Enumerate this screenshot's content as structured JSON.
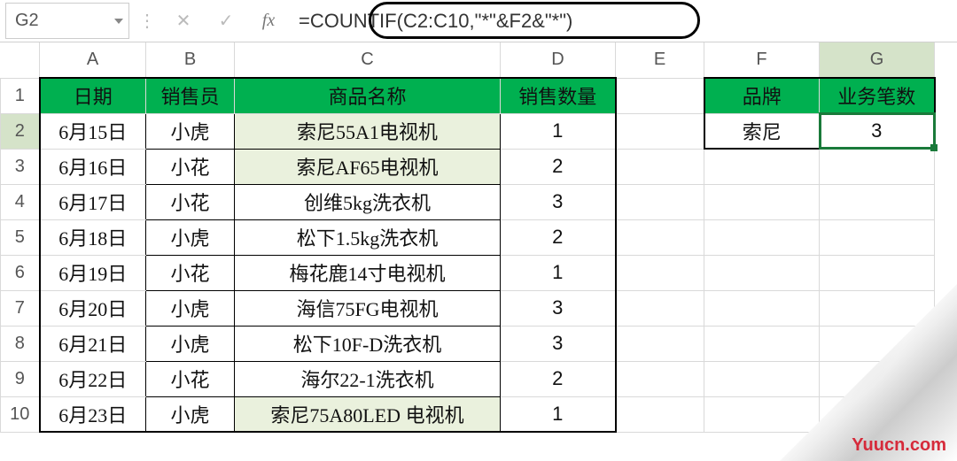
{
  "formula_bar": {
    "cell_ref": "G2",
    "cancel_glyph": "✕",
    "accept_glyph": "✓",
    "fx_label": "fx",
    "formula": "=COUNTIF(C2:C10,\"*\"&F2&\"*\")"
  },
  "columns": [
    "A",
    "B",
    "C",
    "D",
    "E",
    "F",
    "G"
  ],
  "row_numbers": [
    "1",
    "2",
    "3",
    "4",
    "5",
    "6",
    "7",
    "8",
    "9",
    "10"
  ],
  "main_table": {
    "headers": {
      "A": "日期",
      "B": "销售员",
      "C": "商品名称",
      "D": "销售数量"
    },
    "rows": [
      {
        "A": "6月15日",
        "B": "小虎",
        "C": "索尼55A1电视机",
        "D": "1",
        "hl": true
      },
      {
        "A": "6月16日",
        "B": "小花",
        "C": "索尼AF65电视机",
        "D": "2",
        "hl": true
      },
      {
        "A": "6月17日",
        "B": "小花",
        "C": "创维5kg洗衣机",
        "D": "3",
        "hl": false
      },
      {
        "A": "6月18日",
        "B": "小虎",
        "C": "松下1.5kg洗衣机",
        "D": "2",
        "hl": false
      },
      {
        "A": "6月19日",
        "B": "小花",
        "C": "梅花鹿14寸电视机",
        "D": "1",
        "hl": false
      },
      {
        "A": "6月20日",
        "B": "小虎",
        "C": "海信75FG电视机",
        "D": "3",
        "hl": false
      },
      {
        "A": "6月21日",
        "B": "小虎",
        "C": "松下10F-D洗衣机",
        "D": "3",
        "hl": false
      },
      {
        "A": "6月22日",
        "B": "小花",
        "C": "海尔22-1洗衣机",
        "D": "2",
        "hl": false
      },
      {
        "A": "6月23日",
        "B": "小虎",
        "C": "索尼75A80LED 电视机",
        "D": "1",
        "hl": true
      }
    ]
  },
  "side_table": {
    "headers": {
      "F": "品牌",
      "G": "业务笔数"
    },
    "row": {
      "F": "索尼",
      "G": "3"
    }
  },
  "watermark": "Yuucn.com"
}
